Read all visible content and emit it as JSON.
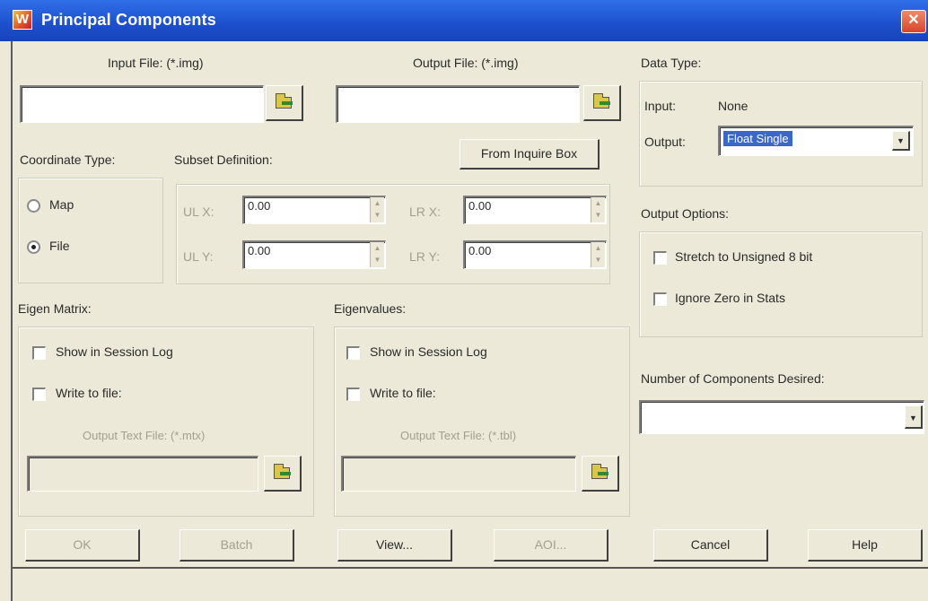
{
  "window": {
    "title": "Principal Components",
    "app_icon": "W"
  },
  "input_file": {
    "label": "Input File: (*.img)",
    "value": ""
  },
  "output_file": {
    "label": "Output File: (*.img)",
    "value": ""
  },
  "coordinate_type": {
    "label": "Coordinate Type:",
    "options": [
      "Map",
      "File"
    ],
    "selected": "File"
  },
  "subset": {
    "label": "Subset Definition:",
    "from_inquire_box": "From Inquire Box",
    "ulx_label": "UL X:",
    "ulx": "0.00",
    "uly_label": "UL Y:",
    "uly": "0.00",
    "lrx_label": "LR X:",
    "lrx": "0.00",
    "lry_label": "LR Y:",
    "lry": "0.00"
  },
  "data_type": {
    "label": "Data Type:",
    "input_label": "Input:",
    "input_value": "None",
    "output_label": "Output:",
    "output_value": "Float Single"
  },
  "output_options": {
    "label": "Output Options:",
    "stretch": "Stretch to Unsigned 8 bit",
    "ignore_zero": "Ignore Zero in Stats"
  },
  "num_components": {
    "label": "Number of Components Desired:",
    "value": ""
  },
  "eigen_matrix": {
    "label": "Eigen Matrix:",
    "show_in_log": "Show in Session Log",
    "write_to_file": "Write to file:",
    "output_text_label": "Output Text File: (*.mtx)",
    "value": ""
  },
  "eigenvalues": {
    "label": "Eigenvalues:",
    "show_in_log": "Show in Session Log",
    "write_to_file": "Write to file:",
    "output_text_label": "Output Text File: (*.tbl)",
    "value": ""
  },
  "buttons": {
    "ok": "OK",
    "batch": "Batch",
    "view": "View...",
    "aoi": "AOI...",
    "cancel": "Cancel",
    "help": "Help"
  },
  "icons": [
    "folder-browse-icon",
    "chevron-down-icon",
    "spin-up-icon",
    "spin-down-icon",
    "close-icon"
  ],
  "colors": {
    "titlebar": "#1d4fcc",
    "dialog_bg": "#ECE9D8",
    "selection": "#3b67c9"
  }
}
